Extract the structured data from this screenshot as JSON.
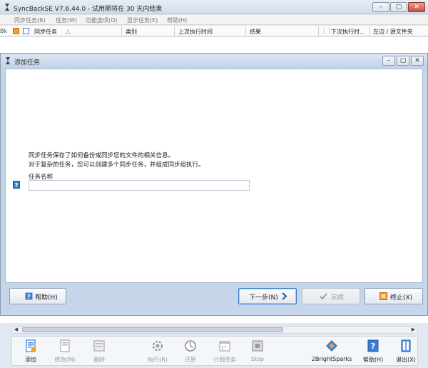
{
  "main_window": {
    "title": "SyncBackSE V7.6.44.0 - 试用期将在 30 天内结束",
    "min_glyph": "–",
    "max_glyph": "▢",
    "close_glyph": "✕",
    "menu": [
      "同步任务(R)",
      "任务(W)",
      "功能选项(O)",
      "显示任务(E)",
      "帮助(H)"
    ],
    "columns": [
      "同步任务",
      "类别",
      "上次执行时间",
      "结果",
      "下次执行时...",
      "左边 / 源文件夹"
    ],
    "left_cut": "Bk",
    "sort_arrow": "△"
  },
  "toolbar": {
    "buttons": [
      {
        "label": "添加",
        "enabled": true
      },
      {
        "label": "修改(M)",
        "enabled": false
      },
      {
        "label": "删除",
        "enabled": false
      },
      {
        "label": "执行(R)",
        "enabled": false
      },
      {
        "label": "还原",
        "enabled": false
      },
      {
        "label": "计划任务",
        "enabled": false
      },
      {
        "label": "Stop",
        "enabled": false
      },
      {
        "label": "2BrightSparks",
        "enabled": true
      },
      {
        "label": "帮助(H)",
        "enabled": true
      },
      {
        "label": "退出(X)",
        "enabled": true
      }
    ]
  },
  "dialog": {
    "title": "添加任务",
    "min_glyph": "–",
    "max_glyph": "▢",
    "close_glyph": "✕",
    "description_line1": "同步任务保存了如何备份或同步您的文件的相关信息。",
    "description_line2": "对于复杂的任务，您可以创建多个同步任务，并组成同步组执行。",
    "task_name_label": "任务名称",
    "task_name_value": "",
    "help_mark": "?",
    "buttons": {
      "help": "帮助(H)",
      "next": "下一步(N)",
      "finish": "完成",
      "stop": "终止(X)"
    }
  },
  "colors": {
    "accent": "#3c7fd0",
    "orange": "#f0a030"
  }
}
